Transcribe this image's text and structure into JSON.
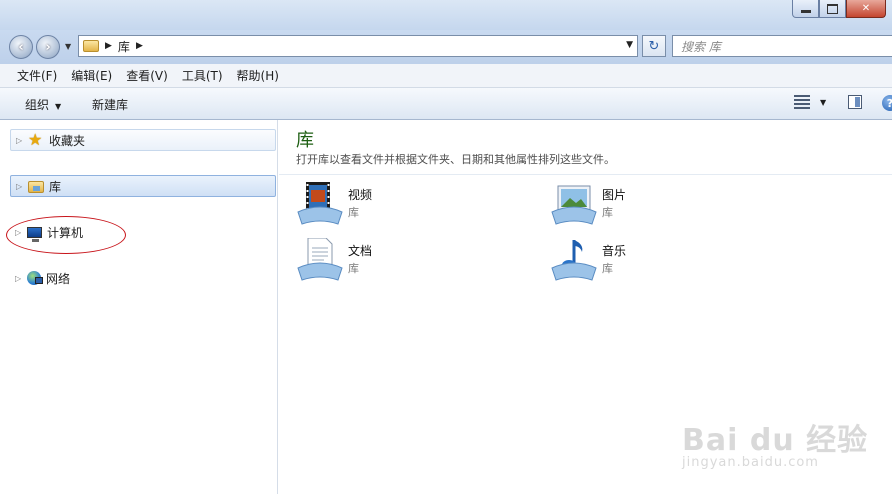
{
  "window": {
    "minimize_icon": "minimize-icon",
    "maximize_icon": "maximize-icon",
    "close_label": "✕"
  },
  "address_bar": {
    "path": "库",
    "search_placeholder": "搜索 库"
  },
  "menu": [
    {
      "label": "文件(F)"
    },
    {
      "label": "编辑(E)"
    },
    {
      "label": "查看(V)"
    },
    {
      "label": "工具(T)"
    },
    {
      "label": "帮助(H)"
    }
  ],
  "toolbar": {
    "organize_label": "组织",
    "new_library_label": "新建库",
    "help_label": "?"
  },
  "nav_pane": {
    "items": [
      {
        "label": "收藏夹",
        "icon": "favorites-star-icon"
      },
      {
        "label": "库",
        "icon": "libraries-icon",
        "selected": true
      },
      {
        "label": "计算机",
        "icon": "computer-icon"
      },
      {
        "label": "网络",
        "icon": "network-icon"
      }
    ]
  },
  "content": {
    "title": "库",
    "subtitle": "打开库以查看文件并根据文件夹、日期和其他属性排列这些文件。",
    "libraries": [
      {
        "name": "视频",
        "type": "库",
        "icon": "videos-library-icon"
      },
      {
        "name": "图片",
        "type": "库",
        "icon": "pictures-library-icon"
      },
      {
        "name": "文档",
        "type": "库",
        "icon": "documents-library-icon"
      },
      {
        "name": "音乐",
        "type": "库",
        "icon": "music-library-icon"
      }
    ]
  },
  "watermark": {
    "main": "Bai du 经验",
    "sub": "jingyan.baidu.com"
  },
  "colors": {
    "title_green": "#1e5f13",
    "annotation_red": "#c8151b",
    "frame_blue": "#c5d7ee"
  }
}
